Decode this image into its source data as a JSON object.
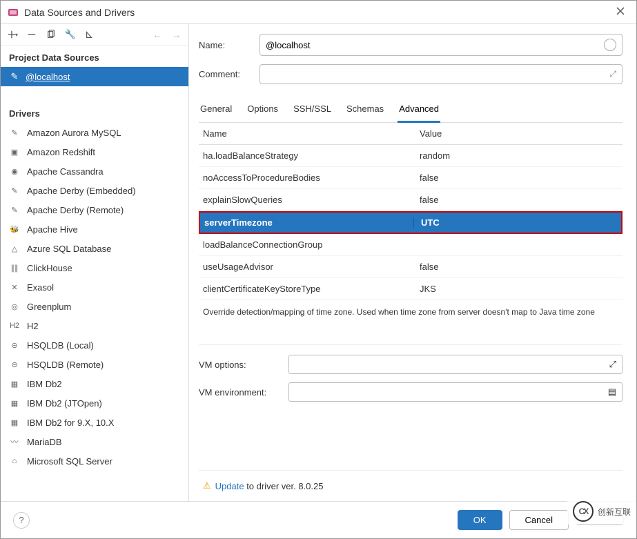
{
  "window": {
    "title": "Data Sources and Drivers"
  },
  "sidebar": {
    "project_header": "Project Data Sources",
    "datasource": {
      "label": "@localhost"
    },
    "drivers_header": "Drivers",
    "drivers": [
      {
        "label": "Amazon Aurora MySQL",
        "glyph": "✎"
      },
      {
        "label": "Amazon Redshift",
        "glyph": "▣"
      },
      {
        "label": "Apache Cassandra",
        "glyph": "◉"
      },
      {
        "label": "Apache Derby (Embedded)",
        "glyph": "✎"
      },
      {
        "label": "Apache Derby (Remote)",
        "glyph": "✎"
      },
      {
        "label": "Apache Hive",
        "glyph": "🐝"
      },
      {
        "label": "Azure SQL Database",
        "glyph": "△"
      },
      {
        "label": "ClickHouse",
        "glyph": "∥∥"
      },
      {
        "label": "Exasol",
        "glyph": "✕"
      },
      {
        "label": "Greenplum",
        "glyph": "◎"
      },
      {
        "label": "H2",
        "glyph": "H2"
      },
      {
        "label": "HSQLDB (Local)",
        "glyph": "⊝"
      },
      {
        "label": "HSQLDB (Remote)",
        "glyph": "⊝"
      },
      {
        "label": "IBM Db2",
        "glyph": "▦"
      },
      {
        "label": "IBM Db2 (JTOpen)",
        "glyph": "▦"
      },
      {
        "label": "IBM Db2 for 9.X, 10.X",
        "glyph": "▦"
      },
      {
        "label": "MariaDB",
        "glyph": "〰"
      },
      {
        "label": "Microsoft SQL Server",
        "glyph": "⌂"
      }
    ]
  },
  "form": {
    "name_label": "Name:",
    "name_value": "@localhost",
    "comment_label": "Comment:",
    "comment_value": ""
  },
  "tabs": [
    "General",
    "Options",
    "SSH/SSL",
    "Schemas",
    "Advanced"
  ],
  "active_tab": 4,
  "grid": {
    "headers": {
      "name": "Name",
      "value": "Value"
    },
    "rows": [
      {
        "name": "ha.loadBalanceStrategy",
        "value": "random"
      },
      {
        "name": "noAccessToProcedureBodies",
        "value": "false"
      },
      {
        "name": "explainSlowQueries",
        "value": "false"
      },
      {
        "name": "serverTimezone",
        "value": "UTC",
        "selected": true
      },
      {
        "name": "loadBalanceConnectionGroup",
        "value": ""
      },
      {
        "name": "useUsageAdvisor",
        "value": "false"
      },
      {
        "name": "clientCertificateKeyStoreType",
        "value": "JKS"
      }
    ],
    "help": "Override detection/mapping of time zone. Used when time zone from server doesn't map to Java time zone"
  },
  "vm": {
    "options_label": "VM options:",
    "options_value": "",
    "env_label": "VM environment:",
    "env_value": ""
  },
  "update_bar": {
    "link": "Update",
    "rest": " to driver ver. 8.0.25"
  },
  "buttons": {
    "ok": "OK",
    "cancel": "Cancel"
  },
  "watermark": {
    "brand": "创新互联",
    "logo": "CX"
  }
}
